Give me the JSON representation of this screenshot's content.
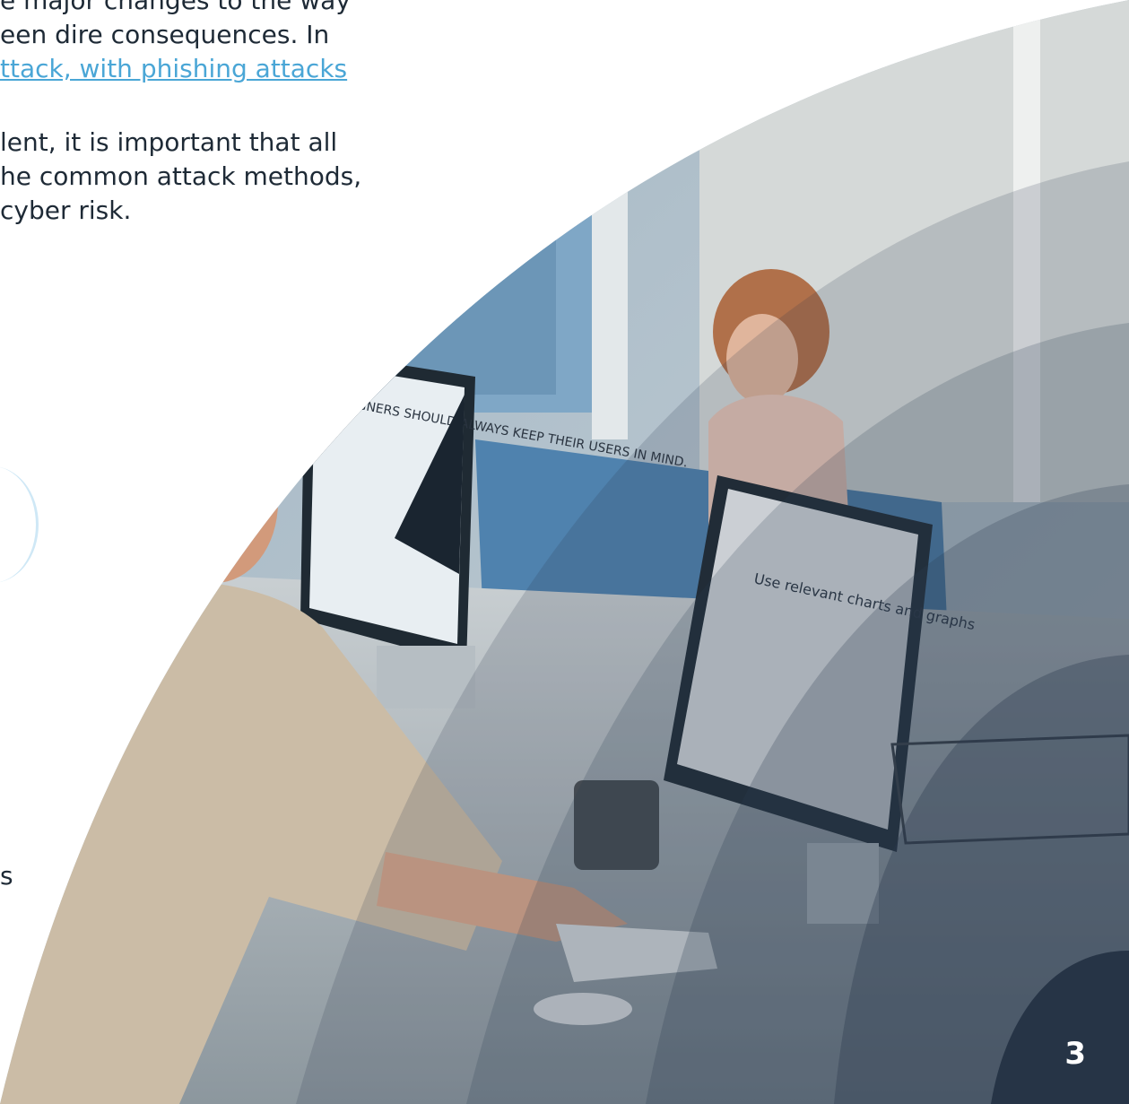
{
  "body_text": {
    "lines": [
      "e major changes to the way",
      "een dire consequences. In",
      "ttack, with phishing attacks"
    ],
    "p2_lines": [
      "lent, it is important that all",
      "he common attack methods,",
      "cyber risk."
    ],
    "stray_letter": "s"
  },
  "photo": {
    "screen1_text": "DESIGNERS SHOULD ALWAYS KEEP THEIR USERS IN MIND.",
    "screen2_heading": "Use relevant charts and graphs"
  },
  "colors": {
    "overlay": "#2a3a4e",
    "link": "#4aa6d6",
    "text": "#1e2a36"
  },
  "page_number": "3"
}
